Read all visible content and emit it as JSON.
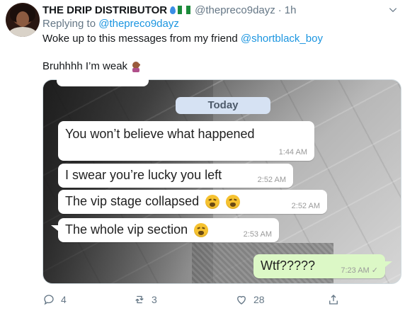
{
  "tweet": {
    "author_name": "THE DRIP DISTRIBUTOR",
    "author_handle": "@thepreco9dayz",
    "time_ago": "1h",
    "replying_label": "Replying to",
    "replying_to": "@thepreco9dayz",
    "text_line1_prefix": "Woke up to this messages from my friend",
    "text_line1_mention": "@shortblack_boy",
    "text_line2": "Bruhhhh I’m weak"
  },
  "chat": {
    "date_chip": "Today",
    "messages": [
      {
        "text": "You won’t believe what happened",
        "time": "1:44 AM"
      },
      {
        "text": "I swear you’re lucky you left",
        "time": "2:52 AM"
      },
      {
        "text": "The vip stage collapsed",
        "time": "2:52 AM"
      },
      {
        "text": "The whole vip section",
        "time": "2:53 AM"
      }
    ],
    "sent": {
      "text": "Wtf?????",
      "time": "7:23 AM",
      "status_icon": "double-check"
    }
  },
  "actions": {
    "reply_count": "4",
    "retweet_count": "3",
    "like_count": "28"
  },
  "colors": {
    "link": "#1b95e0",
    "muted": "#657786",
    "outgoing_bubble": "#dcf8c6",
    "date_chip": "#d6e2f3"
  }
}
